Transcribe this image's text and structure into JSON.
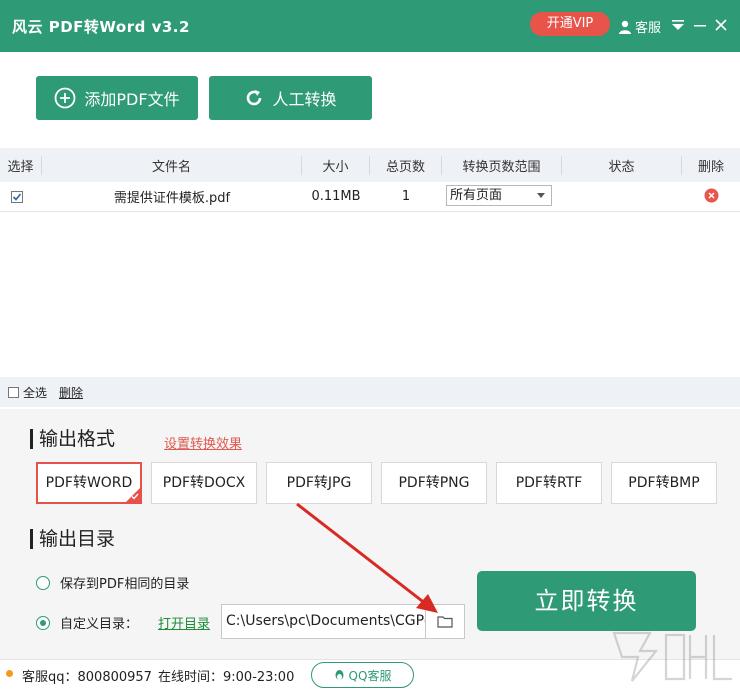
{
  "titlebar": {
    "title": "风云 PDF转Word v3.2",
    "vip_label": "开通VIP",
    "service_label": "客服",
    "brand_color": "#2e9a76",
    "vip_color": "#e8534a"
  },
  "toolbar": {
    "add_pdf_label": "添加PDF文件",
    "manual_convert_label": "人工转换"
  },
  "table": {
    "headers": {
      "select": "选择",
      "filename": "文件名",
      "size": "大小",
      "pages": "总页数",
      "range": "转换页数范围",
      "status": "状态",
      "delete": "删除"
    },
    "rows": [
      {
        "checked": true,
        "filename": "需提供证件模板.pdf",
        "size": "0.11MB",
        "pages": "1",
        "range": "所有页面",
        "status": ""
      }
    ]
  },
  "bottom_bar": {
    "select_all_label": "全选",
    "delete_label": "删除"
  },
  "output_format": {
    "title": "输出格式",
    "settings_link": "设置转换效果",
    "options": [
      "PDF转WORD",
      "PDF转DOCX",
      "PDF转JPG",
      "PDF转PNG",
      "PDF转RTF",
      "PDF转BMP"
    ],
    "selected": "PDF转WORD",
    "accent_color": "#e6524a"
  },
  "output_dir": {
    "title": "输出目录",
    "same_dir_label": "保存到PDF相同的目录",
    "custom_dir_label": "自定义目录：",
    "open_dir_label": "打开目录",
    "path": "C:\\Users\\pc\\Documents\\CGPd"
  },
  "convert": {
    "label": "立即转换"
  },
  "footer": {
    "qq_text": "客服qq：800800957",
    "hours_text": "在线时间：9:00-23:00",
    "qq_button_label": "QQ客服"
  },
  "icons": {
    "add": "plus-circle-icon",
    "manual": "refresh-icon",
    "user": "user-icon",
    "menu": "triangle-down-icon",
    "minimize": "minimize-icon",
    "close": "close-icon",
    "delete_row": "red-delete-icon",
    "folder": "folder-icon",
    "qq": "qq-penguin-icon"
  }
}
